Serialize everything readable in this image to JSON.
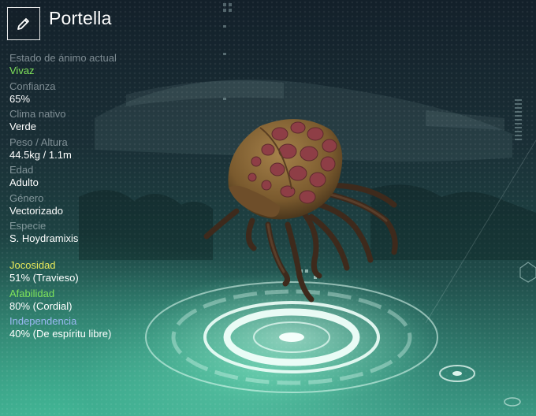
{
  "creature": {
    "name": "Portella"
  },
  "stats": [
    {
      "label": "Estado de ánimo actual",
      "value": "Vivaz",
      "highlight": true
    },
    {
      "label": "Confianza",
      "value": "65%"
    },
    {
      "label": "Clima nativo",
      "value": "Verde"
    },
    {
      "label": "Peso / Altura",
      "value": "44.5kg / 1.1m"
    },
    {
      "label": "Edad",
      "value": "Adulto"
    },
    {
      "label": "Género",
      "value": "Vectorizado"
    },
    {
      "label": "Especie",
      "value": "S. Hoydramixis"
    }
  ],
  "traits": [
    {
      "label": "Jocosidad",
      "value": "51% (Travieso)",
      "color": "#e8e85a"
    },
    {
      "label": "Afabilidad",
      "value": "80% (Cordial)",
      "color": "#7fe35a"
    },
    {
      "label": "Independencia",
      "value": "40% (De espíritu libre)",
      "color": "#9ab8f2"
    }
  ],
  "icons": {
    "edit": "pencil-icon"
  },
  "colors": {
    "mood": "#7fe35a",
    "creature_shell": "#8a6a3a",
    "creature_spots": "#8e3e46",
    "hologram": "#e8fff6"
  }
}
